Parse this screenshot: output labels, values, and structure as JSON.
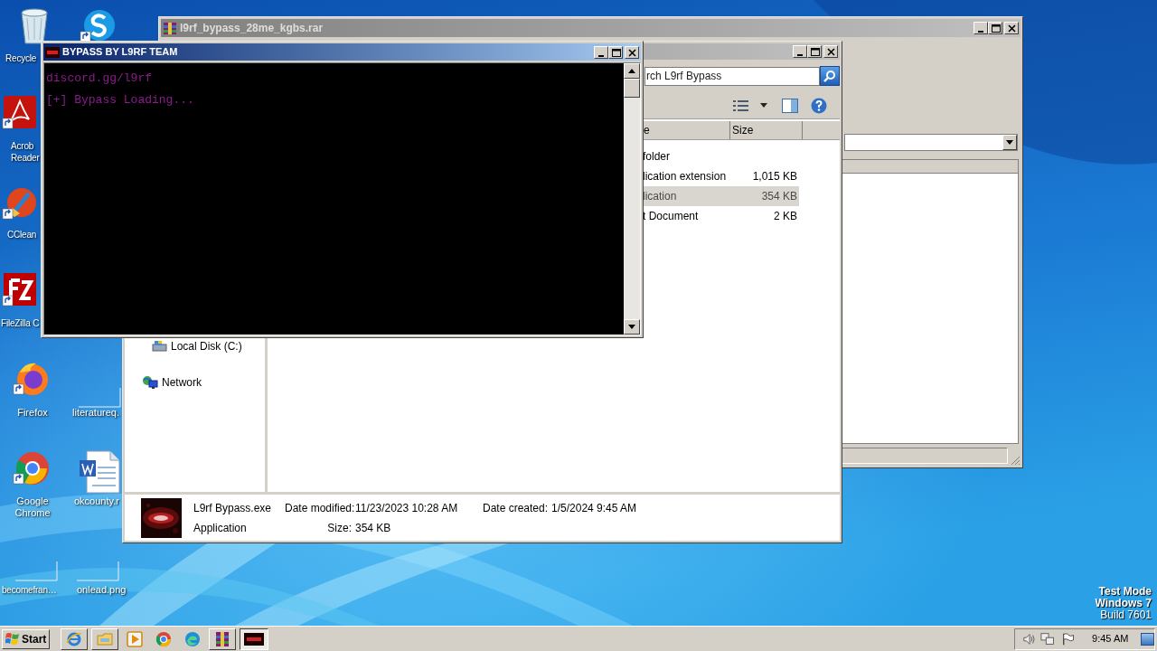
{
  "desktop": {
    "icons": [
      {
        "kind": "recycle-bin",
        "label_lines": [
          "Recycle"
        ]
      },
      {
        "kind": "skype"
      },
      {
        "kind": "acrobat",
        "label_lines": [
          "Acrob",
          "Reader"
        ]
      },
      {
        "kind": "ccleaner",
        "label_lines": [
          "CClean"
        ]
      },
      {
        "kind": "filezilla",
        "label_lines": [
          "FileZilla C"
        ]
      },
      {
        "kind": "firefox",
        "label_lines": [
          "Firefox"
        ]
      },
      {
        "kind": "blank-file",
        "label_lines": [
          "literatureq."
        ]
      },
      {
        "kind": "chrome",
        "label_lines": [
          "Google",
          "Chrome"
        ]
      },
      {
        "kind": "word-doc",
        "label_lines": [
          "okcounty.r"
        ]
      },
      {
        "kind": "blank-file",
        "label_lines": [
          "becomefran…"
        ]
      },
      {
        "kind": "blank-file",
        "label_lines": [
          "onlead.png"
        ]
      }
    ]
  },
  "archive_window": {
    "title": "l9rf_bypass_28me_kgbs.rar",
    "active": false
  },
  "explorer_window": {
    "active": false,
    "search": {
      "placeholder": "rch L9rf Bypass"
    },
    "columns": [
      "e",
      "Size"
    ],
    "rows": [
      {
        "type": "folder",
        "selected": false
      },
      {
        "type": "lication extension",
        "size": "1,015 KB",
        "selected": false
      },
      {
        "type": "lication",
        "size": "354 KB",
        "selected": true
      },
      {
        "type": "t Document",
        "size": "2 KB",
        "selected": false
      }
    ],
    "nav": [
      {
        "kind": "drive",
        "label": "Local Disk (C:)"
      },
      {
        "kind": "network",
        "label": "Network"
      }
    ],
    "details": {
      "name": "L9rf Bypass.exe",
      "type": "Application",
      "fields": [
        {
          "label": "Date modified:",
          "value": "11/23/2023 10:28 AM"
        },
        {
          "label": "Size:",
          "value": "354 KB"
        },
        {
          "label": "Date created:",
          "value": "1/5/2024 9:45 AM"
        }
      ]
    }
  },
  "console_window": {
    "title": "BYPASS BY L9RF TEAM",
    "active": true,
    "lines": [
      "discord.gg/l9rf",
      "[+] Bypass Loading..."
    ]
  },
  "taskbar": {
    "start_label": "Start",
    "buttons": [
      {
        "kind": "ie",
        "open": true,
        "selected": false
      },
      {
        "kind": "explorer",
        "open": true,
        "selected": false
      },
      {
        "kind": "media",
        "open": false,
        "selected": false
      },
      {
        "kind": "chrome",
        "open": false,
        "selected": false
      },
      {
        "kind": "edge",
        "open": false,
        "selected": false
      },
      {
        "kind": "winrar",
        "open": true,
        "selected": false
      },
      {
        "kind": "l9rf",
        "open": true,
        "selected": true
      }
    ],
    "clock": "9:45 AM"
  },
  "system_notice": [
    "Test Mode",
    "Windows 7",
    "Build 7601"
  ]
}
